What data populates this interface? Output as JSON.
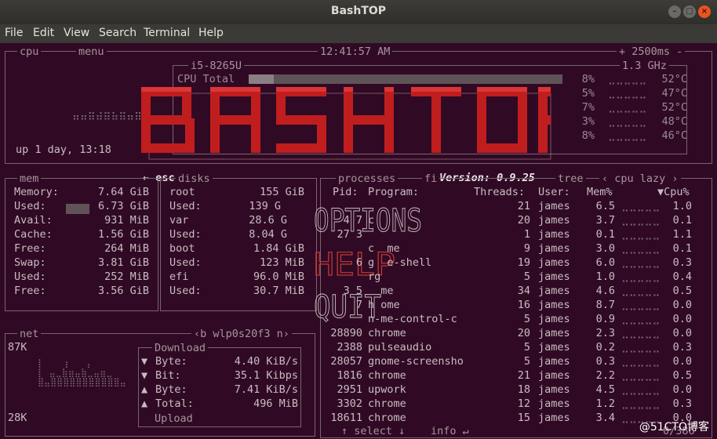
{
  "window": {
    "title": "BashTOP"
  },
  "menu": [
    "File",
    "Edit",
    "View",
    "Search",
    "Terminal",
    "Help"
  ],
  "header": {
    "cpu_label": "cpu",
    "menu_label": "menu",
    "clock": "12:41:57 AM",
    "interval": "+ 2500ms -"
  },
  "cpu": {
    "model": "i5-8265U",
    "freq": "1.3 GHz",
    "total_label": "CPU Total",
    "total_pct": "8%",
    "total_temp": "52°C",
    "total_fraction": 0.08,
    "cores": [
      {
        "pct": "5%",
        "temp": "47°C"
      },
      {
        "pct": "7%",
        "temp": "52°C"
      },
      {
        "pct": "3%",
        "temp": "48°C"
      },
      {
        "pct": "8%",
        "temp": "46°C"
      }
    ],
    "uptime": "up 1 day, 13:18"
  },
  "overlay": {
    "version": "Version: 0.9.25",
    "esc": "← esc",
    "options": "OPTIONS",
    "help": "HELP",
    "quit": "QUIT"
  },
  "mem": {
    "label": "mem",
    "rows": [
      {
        "k": "Memory:",
        "v": "7.64 GiB"
      },
      {
        "k": "Used:",
        "v": "6.73 GiB"
      },
      {
        "k": "Avail:",
        "v": "931 MiB"
      },
      {
        "k": "Cache:",
        "v": "1.56 GiB"
      },
      {
        "k": "Free:",
        "v": "264 MiB"
      },
      {
        "k": "Swap:",
        "v": "3.81 GiB"
      },
      {
        "k": "Used:",
        "v": "252 MiB"
      },
      {
        "k": "Free:",
        "v": "3.56 GiB"
      }
    ]
  },
  "disks": {
    "label": "disks",
    "rows": [
      {
        "k": "root",
        "v": "155 GiB"
      },
      {
        "k": "Used:",
        "v": "139 G"
      },
      {
        "k": "var",
        "v": "28.6 G"
      },
      {
        "k": "Used:",
        "v": "8.04 G"
      },
      {
        "k": "boot",
        "v": "1.84 GiB"
      },
      {
        "k": "Used:",
        "v": "123 MiB"
      },
      {
        "k": "efi",
        "v": "96.0 MiB"
      },
      {
        "k": "Used:",
        "v": "30.7 MiB"
      }
    ]
  },
  "net": {
    "label": "net",
    "iface": "‹b wlp0s20f3 n›",
    "max": "87K",
    "min": "28K",
    "download_label": "Download",
    "upload_label": "Upload",
    "rows": [
      {
        "arrow": "▼",
        "k": "Byte:",
        "v": "4.40 KiB/s"
      },
      {
        "arrow": "▼",
        "k": "Bit:",
        "v": "35.1 Kibps"
      },
      {
        "arrow": "▲",
        "k": "Byte:",
        "v": "7.41 KiB/s"
      },
      {
        "arrow": "▲",
        "k": "Total:",
        "v": "496 MiB"
      }
    ]
  },
  "proc": {
    "label": "processes",
    "filter_label": "fi",
    "tree_label": "tree",
    "sort_label": "‹ cpu lazy ›",
    "headers": {
      "pid": "Pid:",
      "program": "Program:",
      "threads": "Threads:",
      "user": "User:",
      "mem": "Mem%",
      "cpu": "▼Cpu%"
    },
    "rows": [
      {
        "pid": "",
        "prog": "",
        "thr": "21",
        "user": "james",
        "mem": "6.5",
        "cpu": "1.0"
      },
      {
        "pid": "4 7",
        "prog": "c",
        "thr": "20",
        "user": "james",
        "mem": "3.7",
        "cpu": "0.1"
      },
      {
        "pid": "27 3",
        "prog": "",
        "thr": "1",
        "user": "james",
        "mem": "0.1",
        "cpu": "1.1"
      },
      {
        "pid": "",
        "prog": "c  me",
        "thr": "9",
        "user": "james",
        "mem": "3.0",
        "cpu": "0.1"
      },
      {
        "pid": "6",
        "prog": "g  e-shell",
        "thr": "19",
        "user": "james",
        "mem": "6.0",
        "cpu": "0.3"
      },
      {
        "pid": "",
        "prog": "rg",
        "thr": "5",
        "user": "james",
        "mem": "1.0",
        "cpu": "0.4"
      },
      {
        "pid": "3 5",
        "prog": "  me",
        "thr": "34",
        "user": "james",
        "mem": "4.6",
        "cpu": "0.5"
      },
      {
        "pid": "7",
        "prog": "h ome",
        "thr": "16",
        "user": "james",
        "mem": "8.7",
        "cpu": "0.0"
      },
      {
        "pid": "",
        "prog": "n-me-control-c",
        "thr": "5",
        "user": "james",
        "mem": "0.9",
        "cpu": "0.0"
      },
      {
        "pid": "28890",
        "prog": "chrome",
        "thr": "20",
        "user": "james",
        "mem": "2.3",
        "cpu": "0.0"
      },
      {
        "pid": "2388",
        "prog": "pulseaudio",
        "thr": "5",
        "user": "james",
        "mem": "0.2",
        "cpu": "0.3"
      },
      {
        "pid": "28057",
        "prog": "gnome-screensho",
        "thr": "5",
        "user": "james",
        "mem": "0.3",
        "cpu": "0.0"
      },
      {
        "pid": "1816",
        "prog": "chrome",
        "thr": "21",
        "user": "james",
        "mem": "2.2",
        "cpu": "0.5"
      },
      {
        "pid": "2951",
        "prog": "upwork",
        "thr": "18",
        "user": "james",
        "mem": "4.5",
        "cpu": "0.0"
      },
      {
        "pid": "3302",
        "prog": "chrome",
        "thr": "12",
        "user": "james",
        "mem": "1.2",
        "cpu": "0.3"
      },
      {
        "pid": "18611",
        "prog": "chrome",
        "thr": "15",
        "user": "james",
        "mem": "3.4",
        "cpu": "0.0"
      }
    ],
    "select_label": "↑ select ↓",
    "info_label": "info ↵",
    "count": "0/386"
  },
  "watermark": "@51CTO博客",
  "colors": {
    "bg": "#300a24",
    "logo_light": "#e02a2a",
    "logo_dark": "#8a1010",
    "help": "#c03838"
  }
}
